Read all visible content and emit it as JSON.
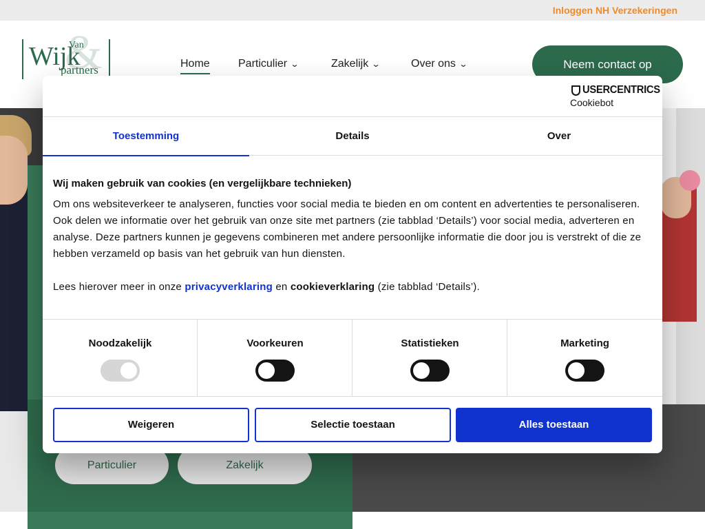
{
  "topbar": {
    "login_link": "Inloggen NH Verzekeringen"
  },
  "logo": {
    "van": "Van",
    "wijk": "Wijk",
    "amp": "&",
    "partners": "partners"
  },
  "nav": {
    "items": [
      {
        "label": "Home",
        "active": true
      },
      {
        "label": "Particulier",
        "has_dropdown": true
      },
      {
        "label": "Zakelijk",
        "has_dropdown": true
      },
      {
        "label": "Over ons",
        "has_dropdown": true
      }
    ],
    "chevron_icon": "chevron-down-icon",
    "contact_button": "Neem contact op"
  },
  "hero": {
    "buttons": [
      "Particulier",
      "Zakelijk"
    ]
  },
  "cookie_dialog": {
    "brand_name": "USERCENTRICS",
    "brand_product": "Cookiebot",
    "tabs": [
      {
        "label": "Toestemming",
        "active": true
      },
      {
        "label": "Details"
      },
      {
        "label": "Over"
      }
    ],
    "heading": "Wij maken gebruik van cookies (en vergelijkbare technieken)",
    "paragraph": "Om ons websiteverkeer te analyseren, functies voor social media te bieden en om content en advertenties te personaliseren. Ook delen we informatie over het gebruik van onze site met partners (zie tabblad ‘Details’) voor social media, adverteren en analyse. Deze partners kunnen je gegevens combineren met andere persoonlijke informatie die door jou is verstrekt of die ze hebben verzameld op basis van het gebruik van hun diensten.",
    "more_prefix": "Lees hierover meer in onze",
    "privacy_link": "privacyverklaring",
    "more_and": "en",
    "cookie_statement": "cookieverklaring",
    "more_suffix": "(zie tabblad ‘Details’).",
    "toggles": [
      {
        "label": "Noodzakelijk",
        "on": true,
        "disabled": true
      },
      {
        "label": "Voorkeuren",
        "on": false
      },
      {
        "label": "Statistieken",
        "on": false
      },
      {
        "label": "Marketing",
        "on": false
      }
    ],
    "buttons": {
      "deny": "Weigeren",
      "allow_selection": "Selectie toestaan",
      "allow_all": "Alles toestaan"
    }
  },
  "colors": {
    "brand_green": "#2c6a4c",
    "login_orange": "#f08a24",
    "cookie_blue": "#1032cf"
  }
}
